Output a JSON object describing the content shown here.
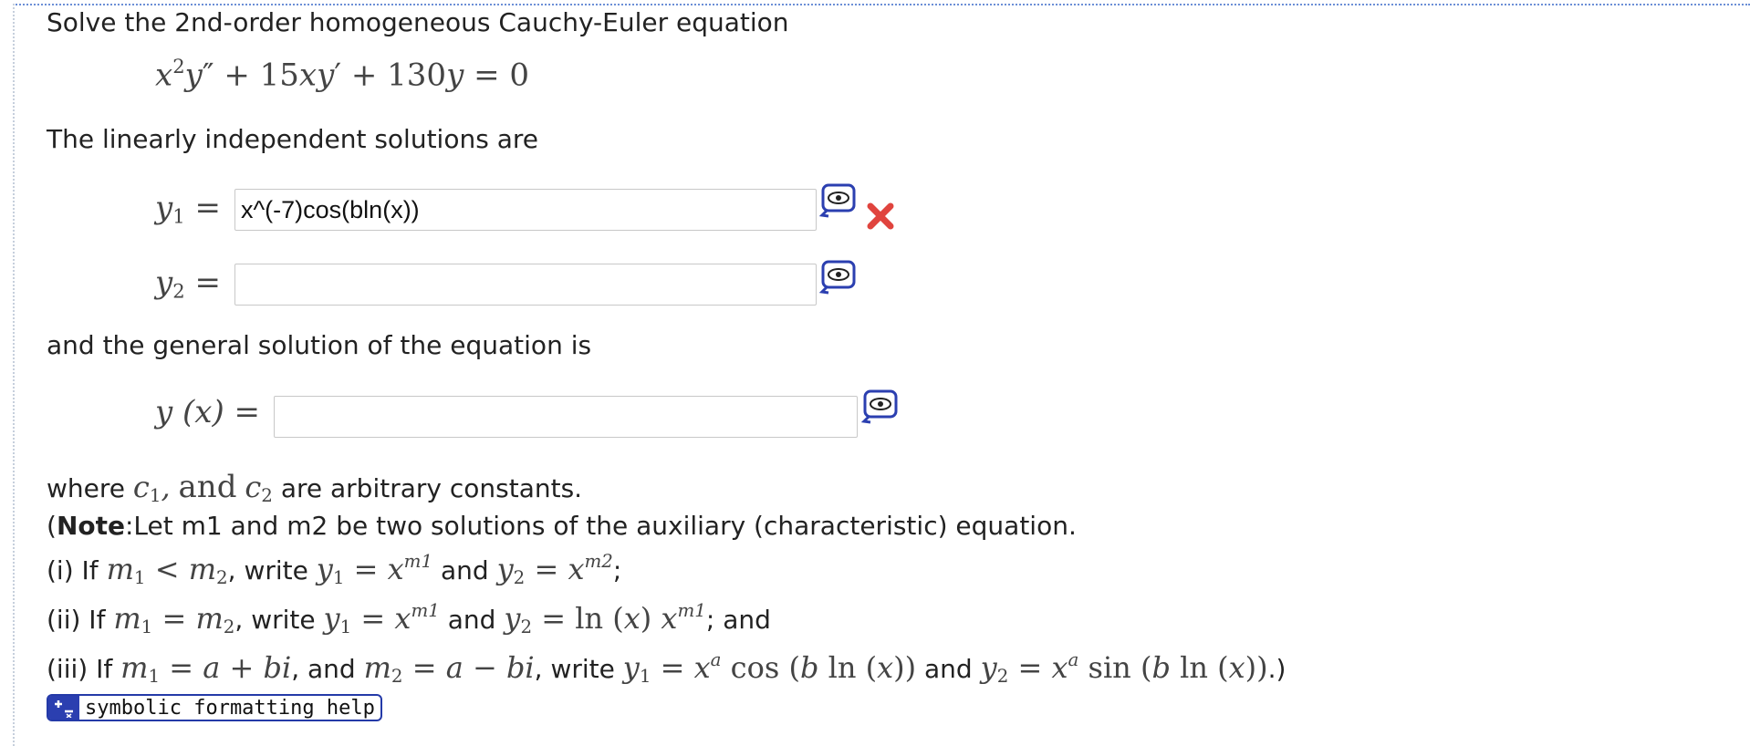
{
  "problem": {
    "intro": "Solve the 2nd-order homogeneous Cauchy-Euler equation",
    "ode": {
      "x": "x",
      "y": "y",
      "exp2": "2",
      "p1": "″",
      "p2": "′",
      "c1": "15",
      "c2": "130",
      "rhs": "0"
    },
    "independent_label": "The linearly independent solutions are",
    "general_label": "and the general solution of the equation is",
    "constants_where": "where",
    "constants_and": "and",
    "constants_rest": "are arbitrary constants."
  },
  "answers": {
    "y1": {
      "label": "y",
      "sub": "1",
      "value": "x^(-7)cos(bln(x))",
      "status": "wrong"
    },
    "y2": {
      "label": "y",
      "sub": "2",
      "value": ""
    },
    "yx": {
      "label": "y (x) =",
      "value": ""
    }
  },
  "note": {
    "open": "(",
    "bold": "Note",
    "line1": ":Let m1 and m2 be two solutions of the auxiliary (characteristic) equation.",
    "case1_prefix": "(i) If",
    "case1_write": ", write",
    "case1_and": "and",
    "case2_prefix": "(ii) If",
    "case2_write": ", write",
    "case2_and": "and",
    "case2_end": "; and",
    "case3_prefix": "(iii) If",
    "case3_and1": ", and",
    "case3_write": ", write",
    "case3_and2": "and",
    "case3_end": ".)"
  },
  "help": {
    "label": "symbolic formatting help",
    "icon": "plus-minus-icon"
  },
  "icons": {
    "preview": "preview-eye-icon",
    "wrong": "red-x-icon"
  },
  "colors": {
    "accent": "#2b3fb0",
    "error": "#e0443e"
  }
}
